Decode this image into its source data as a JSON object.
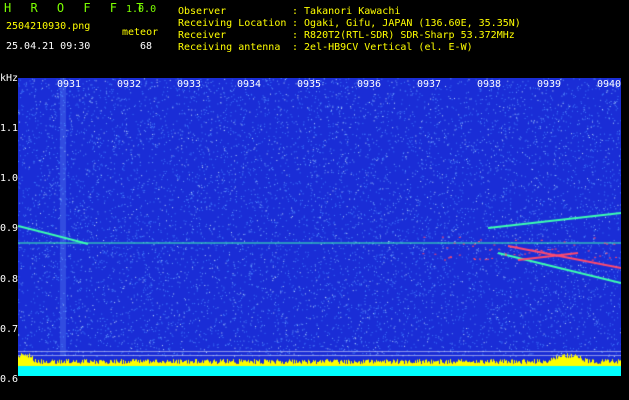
{
  "app": {
    "name": "H R O F F T",
    "version": "1.0.0"
  },
  "file": {
    "name": "2504210930.png",
    "datetime": "25.04.21 09:30"
  },
  "meteor": {
    "label": "meteor",
    "count": "68"
  },
  "info": [
    {
      "label": "Observer",
      "value": ": Takanori Kawachi"
    },
    {
      "label": "Receiving Location",
      "value": ": Ogaki, Gifu, JAPAN (136.60E, 35.35N)"
    },
    {
      "label": "Receiver",
      "value": ": R820T2(RTL-SDR) SDR-Sharp 53.372MHz"
    },
    {
      "label": "Receiving antenna",
      "value": ": 2el-HB9CV Vertical (el. E-W)"
    }
  ],
  "axis": {
    "unit": "kHz",
    "y_ticks": [
      "1.1",
      "1.0",
      "0.9",
      "0.8",
      "0.7",
      "0.6"
    ],
    "x_ticks": [
      "0931",
      "0932",
      "0933",
      "0934",
      "0935",
      "0936",
      "0937",
      "0938",
      "0939",
      "0940"
    ]
  },
  "colors": {
    "background": "#1a2dd6",
    "noise": "#3f7bff",
    "carrier": "#3cffb0",
    "echo": "#ff4a6e",
    "level": "#ffff00",
    "baseline": "#00ffff"
  }
}
